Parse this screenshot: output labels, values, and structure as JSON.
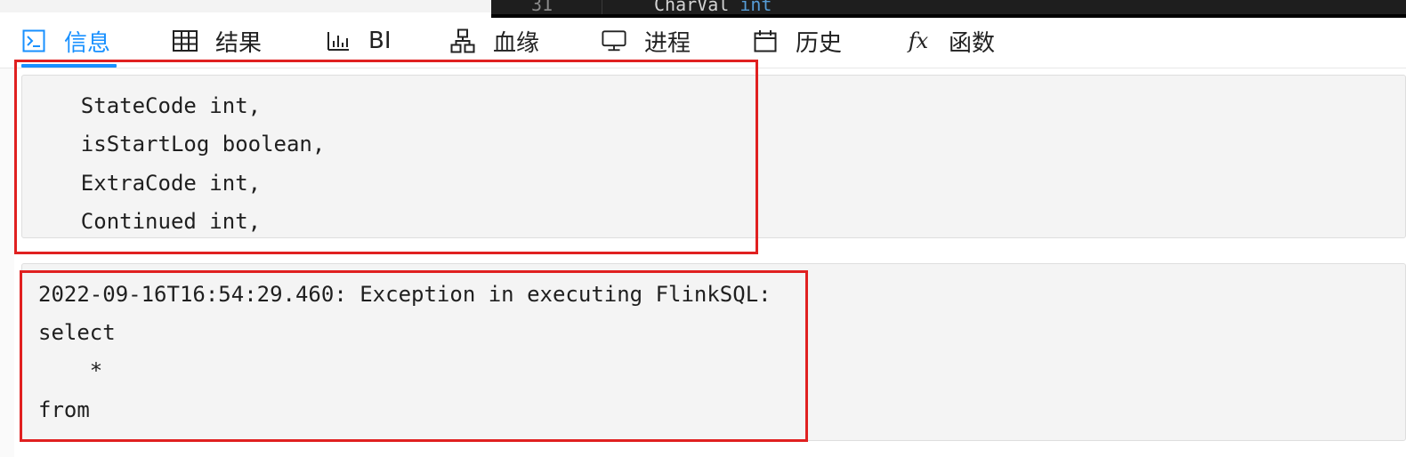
{
  "editor_remnant": {
    "line_number": "31",
    "code_identifier": "CharVal",
    "code_type": "int"
  },
  "tabs": [
    {
      "label": "信息",
      "icon": "terminal-icon",
      "active": true
    },
    {
      "label": "结果",
      "icon": "table-grid-icon",
      "active": false
    },
    {
      "label": "BI",
      "icon": "bar-chart-icon",
      "active": false
    },
    {
      "label": "血缘",
      "icon": "lineage-tree-icon",
      "active": false
    },
    {
      "label": "进程",
      "icon": "monitor-icon",
      "active": false
    },
    {
      "label": "历史",
      "icon": "calendar-icon",
      "active": false
    },
    {
      "label": "函数",
      "icon": "function-fx-icon",
      "active": false
    }
  ],
  "fx_glyph": "fx",
  "log_panels": [
    {
      "lines": [
        "    StateCode int,",
        "    isStartLog boolean,",
        "    ExtraCode int,",
        "    Continued int,"
      ]
    },
    {
      "lines": [
        "2022-09-16T16:54:29.460: Exception in executing FlinkSQL:",
        "select",
        "    *",
        "from"
      ]
    }
  ],
  "colors": {
    "accent": "#1890ff",
    "highlight_border": "#e02020",
    "panel_bg": "#f4f4f4",
    "editor_bg": "#1e1e1e"
  }
}
